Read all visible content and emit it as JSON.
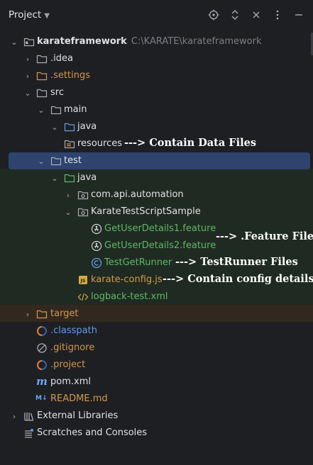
{
  "header": {
    "title": "Project",
    "icons": [
      "target-icon",
      "expand-collapse-icon",
      "close-icon",
      "more-icon",
      "minimize-icon"
    ]
  },
  "tree": {
    "project": {
      "name": "karateframework",
      "path": "C:\\KARATE\\karateframework"
    },
    "idea": ".idea",
    "settings": ".settings",
    "src": "src",
    "main": "main",
    "main_java": "java",
    "resources": "resources",
    "test": "test",
    "test_java": "java",
    "pkg_api": "com.api.automation",
    "pkg_sample": "KarateTestScriptSample",
    "feature1": "GetUserDetails1.feature",
    "feature2": "GetUserDetails2.feature",
    "runner": "TestGetRunner",
    "karate_config": "karate-config.js",
    "logback": "logback-test.xml",
    "target": "target",
    "classpath": ".classpath",
    "gitignore": ".gitignore",
    "dotproject": ".project",
    "pom": "pom.xml",
    "readme": "README.md",
    "ext_libs": "External Libraries",
    "scratches": "Scratches and Consoles"
  },
  "annotations": {
    "resources": "---> Contain Data Files",
    "feature": "---> .Feature Files",
    "runner": "---> TestRunner Files",
    "config": "---> Contain config details"
  },
  "colors": {
    "background": "#1e1f22",
    "selection": "#2e436e",
    "test_green": "#1f2b22",
    "target_brown": "#33281f",
    "settings_orange": "#d2994c",
    "green_text": "#5fb865"
  }
}
